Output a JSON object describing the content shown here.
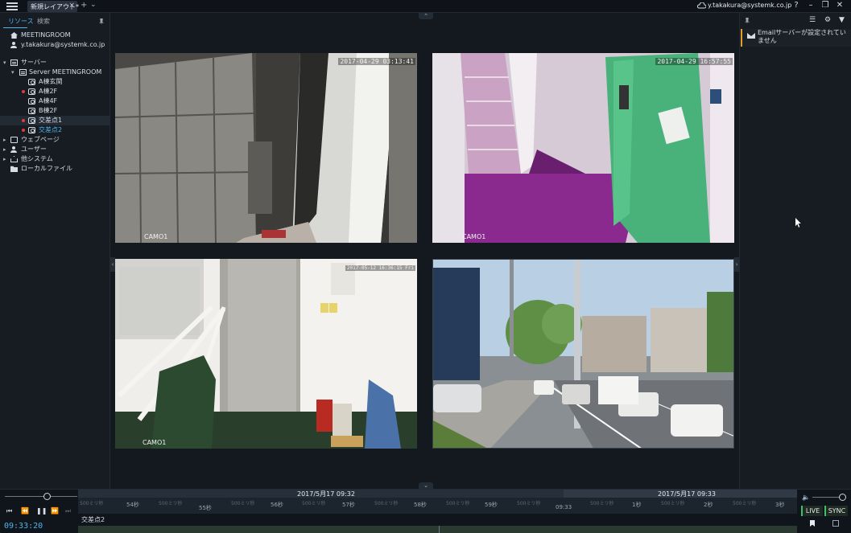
{
  "titlebar": {
    "tab_label": "新規レイアウト*",
    "account": "y.takakura@systemk.co.jp",
    "icons": [
      "help-icon",
      "minimize-icon",
      "restore-icon",
      "close-icon"
    ]
  },
  "sidebar": {
    "tabs": [
      "リソース",
      "検索"
    ],
    "site": "MEETINGROOM",
    "user": "y.takakura@systemk.co.jp",
    "servers_label": "サーバー",
    "server_name": "Server MEETINGROOM",
    "cameras": [
      {
        "label": "A棟玄関",
        "recording": false
      },
      {
        "label": "A棟2F",
        "recording": true
      },
      {
        "label": "A棟4F",
        "recording": false
      },
      {
        "label": "B棟2F",
        "recording": false
      },
      {
        "label": "交差点1",
        "recording": true
      },
      {
        "label": "交差点2",
        "recording": true
      }
    ],
    "other": [
      "ウェブページ",
      "ユーザー",
      "他システム",
      "ローカルファイル"
    ]
  },
  "cameras": [
    {
      "timestamp": "2017-04-29 03:13:41",
      "label": "CAMO1"
    },
    {
      "timestamp": "2017-04-29 16:57:55",
      "label": "CAMO1"
    },
    {
      "timestamp": "2017-05-12 16:36:15 Fri",
      "label": "CAMO1"
    },
    {
      "timestamp": "",
      "label": ""
    }
  ],
  "notifications": {
    "email_notice": "Emailサーバーが設定されていません"
  },
  "timeline": {
    "date_left": "2017/5月17 09:32",
    "date_right": "2017/5月17 09:33",
    "ticks": [
      "54秒",
      "55秒",
      "56秒",
      "57秒",
      "58秒",
      "59秒",
      "09:33",
      "1秒",
      "2秒",
      "3秒"
    ],
    "sub_ticks": [
      "500ミリ秒",
      "500ミリ秒",
      "500ミリ秒",
      "500ミリ秒",
      "500ミリ秒",
      "500ミリ秒",
      "500ミリ秒",
      "500ミリ秒",
      "500ミリ秒",
      "500ミリ秒"
    ],
    "clock": "09:33:20",
    "camera_name": "交差点2",
    "live_label": "LIVE",
    "sync_label": "SYNC"
  }
}
